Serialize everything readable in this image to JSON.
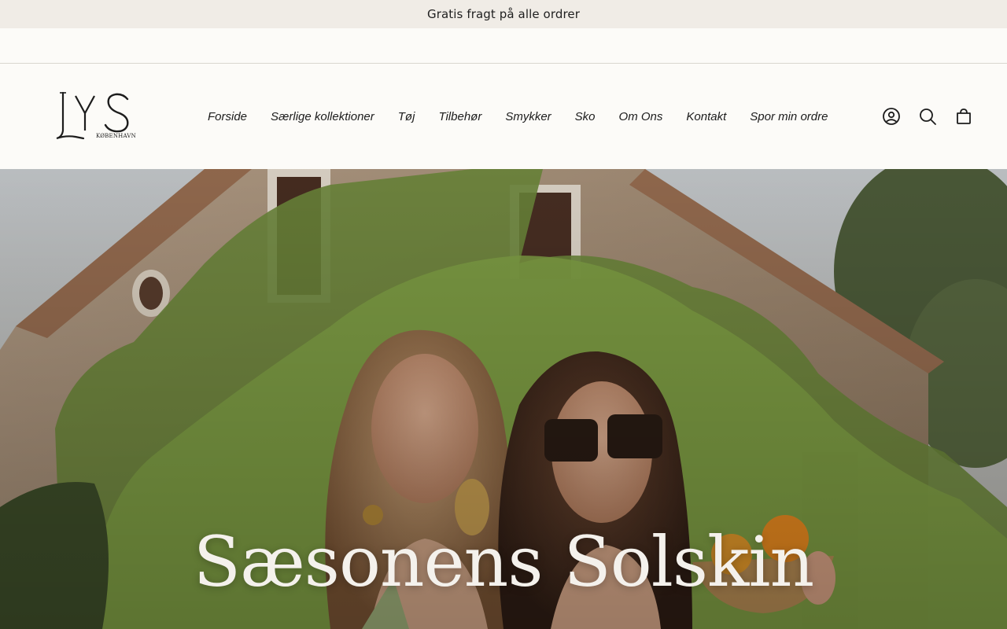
{
  "announcement": {
    "text": "Gratis fragt på alle ordrer"
  },
  "header": {
    "logo": {
      "text": "LYS",
      "subtext": "KØBENHAVN"
    },
    "nav": [
      {
        "label": "Forside"
      },
      {
        "label": "Særlige kollektioner"
      },
      {
        "label": "Tøj"
      },
      {
        "label": "Tilbehør"
      },
      {
        "label": "Smykker"
      },
      {
        "label": "Sko"
      },
      {
        "label": "Om Ons"
      },
      {
        "label": "Kontakt"
      },
      {
        "label": "Spor min ordre"
      }
    ],
    "icons": [
      {
        "name": "account-icon"
      },
      {
        "name": "search-icon"
      },
      {
        "name": "cart-icon"
      }
    ]
  },
  "hero": {
    "title": "Sæsonens Solskin"
  },
  "colors": {
    "announcement_bg": "#f0ece6",
    "page_bg": "#fcfbf8",
    "text": "#1c1c1c",
    "hero_title": "#f4f1ec"
  }
}
